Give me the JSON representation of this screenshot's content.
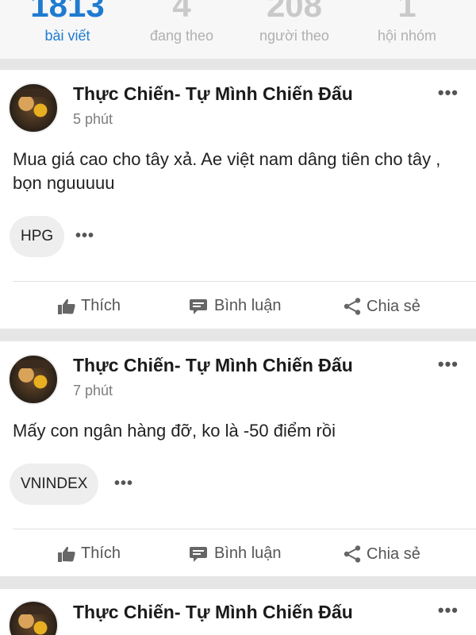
{
  "stats": [
    {
      "value": "1813",
      "label": "bài viết"
    },
    {
      "value": "4",
      "label": "đang theo"
    },
    {
      "value": "208",
      "label": "người theo"
    },
    {
      "value": "1",
      "label": "hội nhóm"
    }
  ],
  "posts": [
    {
      "author": "Thực Chiến- Tự Mình Chiến Đấu",
      "time": "5 phút",
      "content": "Mua giá cao cho tây xả. Ae việt nam dâng tiên cho tây , bọn nguuuuu",
      "tag": "HPG",
      "more_icon": "•••",
      "actions": {
        "like": "Thích",
        "comment": "Bình luận",
        "share": "Chia sẻ"
      }
    },
    {
      "author": "Thực Chiến- Tự Mình Chiến Đấu",
      "time": "7 phút",
      "content": "Mấy con ngân hàng đỡ, ko là -50 điểm rồi",
      "tag": "VNINDEX",
      "more_icon": "•••",
      "actions": {
        "like": "Thích",
        "comment": "Bình luận",
        "share": "Chia sẻ"
      }
    },
    {
      "author": "Thực Chiến- Tự Mình Chiến Đấu",
      "more_icon": "•••"
    }
  ],
  "colors": {
    "accent": "#1f7bd1"
  },
  "icons": {
    "like": "thumbs-up-icon",
    "comment": "comment-icon",
    "share": "share-icon",
    "more": "more-dots-icon"
  }
}
